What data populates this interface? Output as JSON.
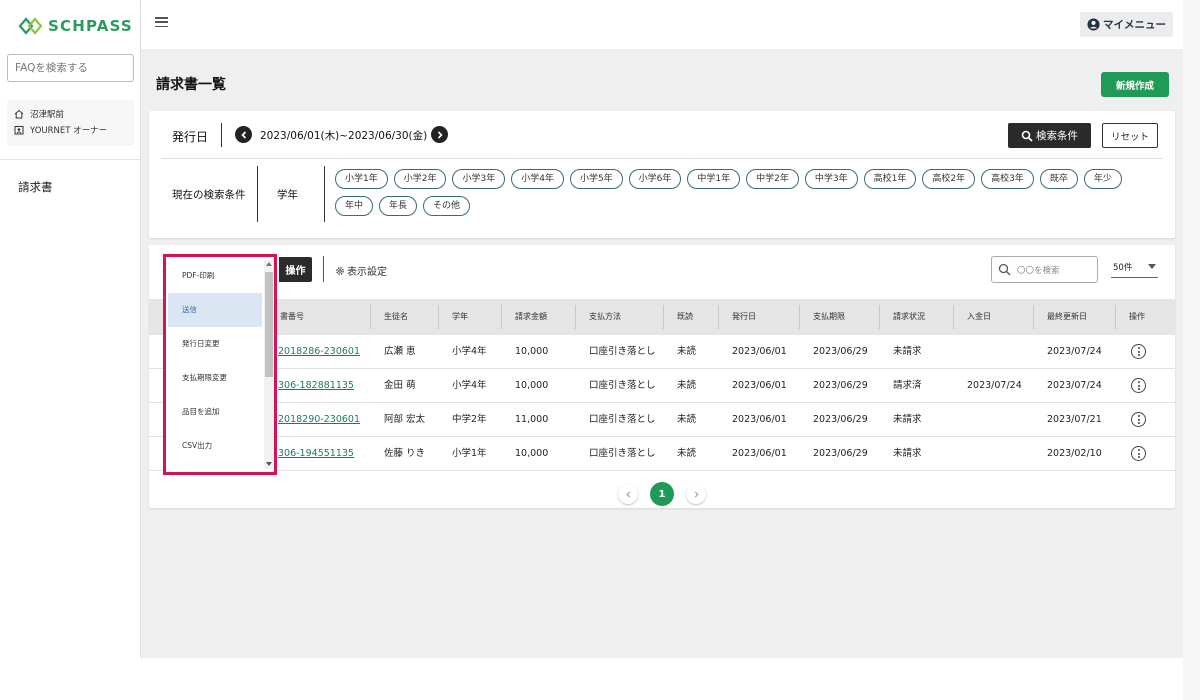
{
  "app": {
    "logo_text": "SCHPASS",
    "brand_color": "#1f9a57"
  },
  "sidebar": {
    "faq_placeholder": "FAQを検索する",
    "school_name": "沼津駅前",
    "org_name": "YOURNET オーナー",
    "nav_items": [
      {
        "label": "請求書"
      }
    ]
  },
  "topbar": {
    "my_menu_label": "マイメニュー"
  },
  "page": {
    "title": "請求書一覧",
    "new_button": "新規作成"
  },
  "search": {
    "issue_date_label": "発行日",
    "date_range": "2023/06/01(木)~2023/06/30(金)",
    "search_button": "検索条件",
    "reset_button": "リセット",
    "current_conditions_label": "現在の検索条件",
    "grade_label": "学年",
    "grade_chips": [
      "小学1年",
      "小学2年",
      "小学3年",
      "小学4年",
      "小学5年",
      "小学6年",
      "中学1年",
      "中学2年",
      "中学3年",
      "高校1年",
      "高校2年",
      "高校3年",
      "既卒",
      "年少",
      "年中",
      "年長",
      "その他"
    ]
  },
  "list": {
    "operations_button": "操作",
    "display_settings": "表示設定",
    "search_placeholder": "〇〇を検索",
    "per_page": "50件",
    "columns": [
      "書番号",
      "生徒名",
      "学年",
      "請求金額",
      "支払方法",
      "既読",
      "発行日",
      "支払期限",
      "請求状況",
      "入金日",
      "最終更新日",
      "操作"
    ],
    "rows": [
      {
        "number": "2018286-230601",
        "student": "広瀬 恵",
        "grade": "小学4年",
        "amount": "10,000",
        "method": "口座引き落とし",
        "read": "未読",
        "issued": "2023/06/01",
        "due": "2023/06/29",
        "status": "未請求",
        "paid": "",
        "updated": "2023/07/24"
      },
      {
        "number": "306-182881135",
        "student": "金田 萌",
        "grade": "小学4年",
        "amount": "10,000",
        "method": "口座引き落とし",
        "read": "未読",
        "issued": "2023/06/01",
        "due": "2023/06/29",
        "status": "請求済",
        "paid": "2023/07/24",
        "updated": "2023/07/24"
      },
      {
        "number": "2018290-230601",
        "student": "阿部 宏太",
        "grade": "中学2年",
        "amount": "11,000",
        "method": "口座引き落とし",
        "read": "未読",
        "issued": "2023/06/01",
        "due": "2023/06/29",
        "status": "未請求",
        "paid": "",
        "updated": "2023/07/21"
      },
      {
        "number": "306-194551135",
        "student": "佐藤 りき",
        "grade": "小学1年",
        "amount": "10,000",
        "method": "口座引き落とし",
        "read": "未読",
        "issued": "2023/06/01",
        "due": "2023/06/29",
        "status": "未請求",
        "paid": "",
        "updated": "2023/02/10"
      }
    ],
    "pagination": {
      "current_page": "1"
    }
  },
  "dropdown": {
    "items": [
      {
        "label": "PDF-印刷"
      },
      {
        "label": "送信"
      },
      {
        "label": "発行日変更"
      },
      {
        "label": "支払期限変更"
      },
      {
        "label": "品目を追加"
      },
      {
        "label": "CSV出力"
      }
    ],
    "active_index": 1,
    "highlight_color": "#d4145a"
  }
}
